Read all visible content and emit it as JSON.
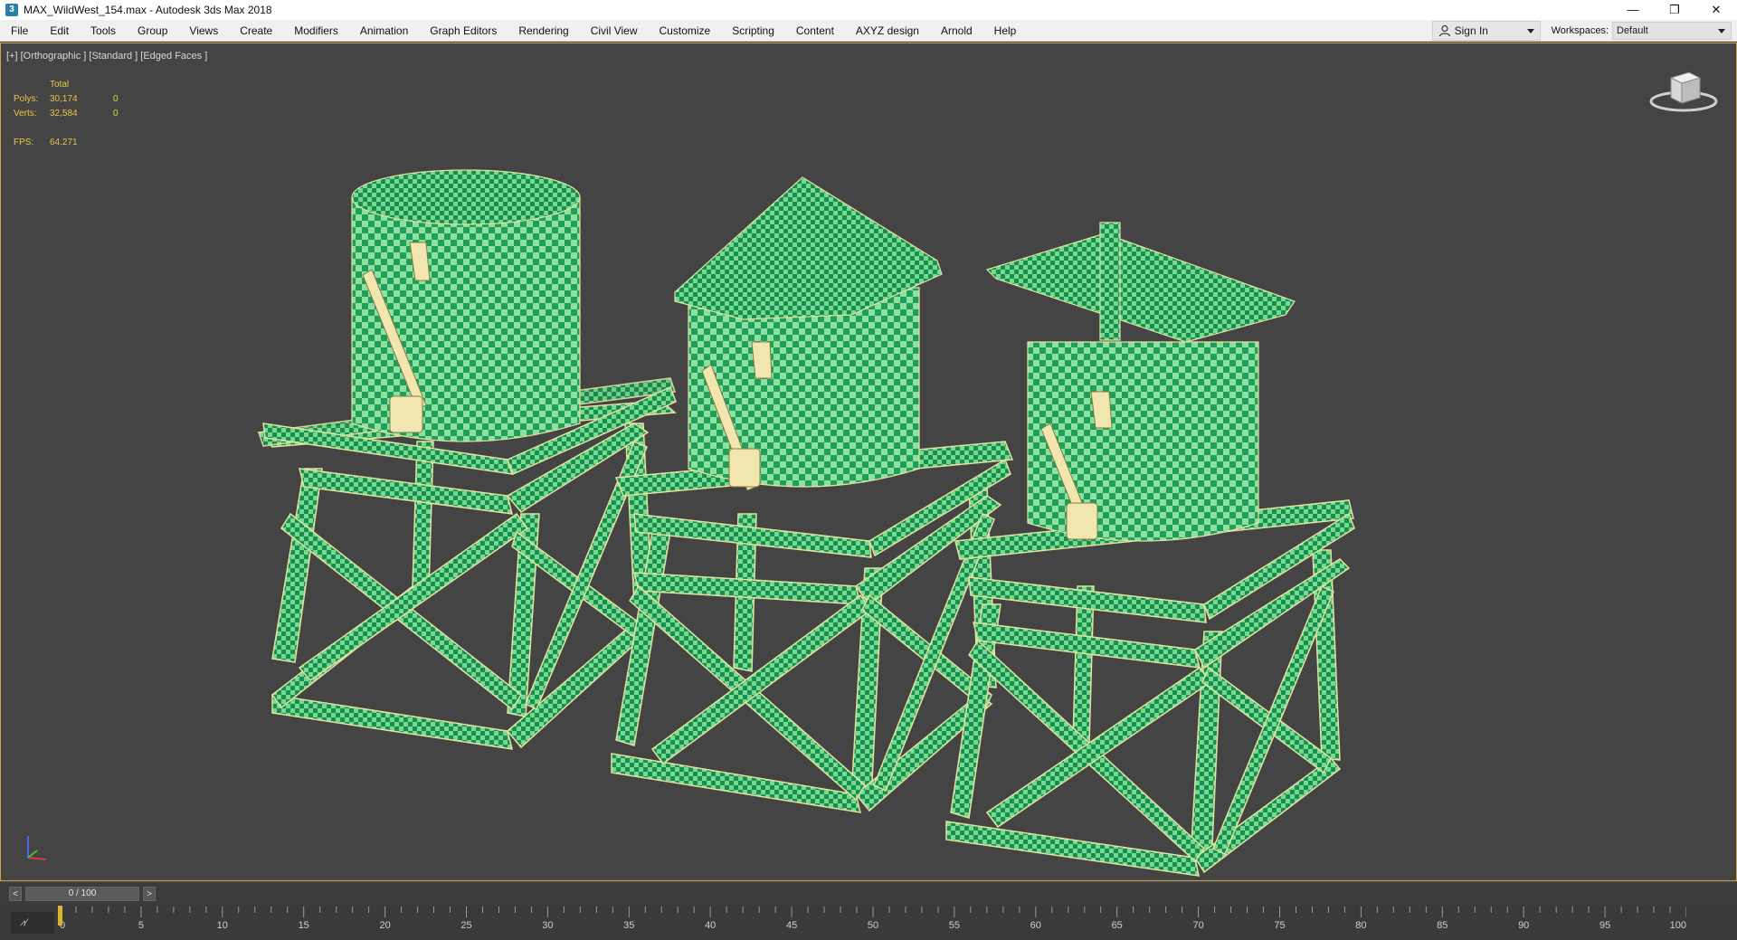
{
  "window": {
    "title": "MAX_WildWest_154.max - Autodesk 3ds Max 2018",
    "app_icon": "3",
    "controls": {
      "minimize": "—",
      "restore": "❐",
      "close": "✕"
    }
  },
  "menu": {
    "items": [
      "File",
      "Edit",
      "Tools",
      "Group",
      "Views",
      "Create",
      "Modifiers",
      "Animation",
      "Graph Editors",
      "Rendering",
      "Civil View",
      "Customize",
      "Scripting",
      "Content",
      "AXYZ design",
      "Arnold",
      "Help"
    ],
    "sign_in": "Sign In",
    "workspaces_label": "Workspaces:",
    "workspace_value": "Default"
  },
  "viewport": {
    "label": "[+] [Orthographic ] [Standard ] [Edged Faces ]",
    "stats": {
      "total_header": "Total",
      "polys_label": "Polys:",
      "polys_value": "30,174",
      "polys_sel": "0",
      "verts_label": "Verts:",
      "verts_value": "32,584",
      "verts_sel": "0",
      "fps_label": "FPS:",
      "fps_value": "64.271"
    },
    "colors": {
      "background": "#444444",
      "mesh_green": "#34b06a",
      "mesh_light": "#8fe0a0",
      "wire": "#e8e0a0",
      "stat_text": "#e8c84a"
    }
  },
  "timeline": {
    "prev": "<",
    "next": ">",
    "frame_display": "0 / 100",
    "ticks": [
      "0",
      "5",
      "10",
      "15",
      "20",
      "25",
      "30",
      "35",
      "40",
      "45",
      "50",
      "55",
      "60",
      "65",
      "70",
      "75",
      "80",
      "85",
      "90",
      "95",
      "100"
    ]
  }
}
